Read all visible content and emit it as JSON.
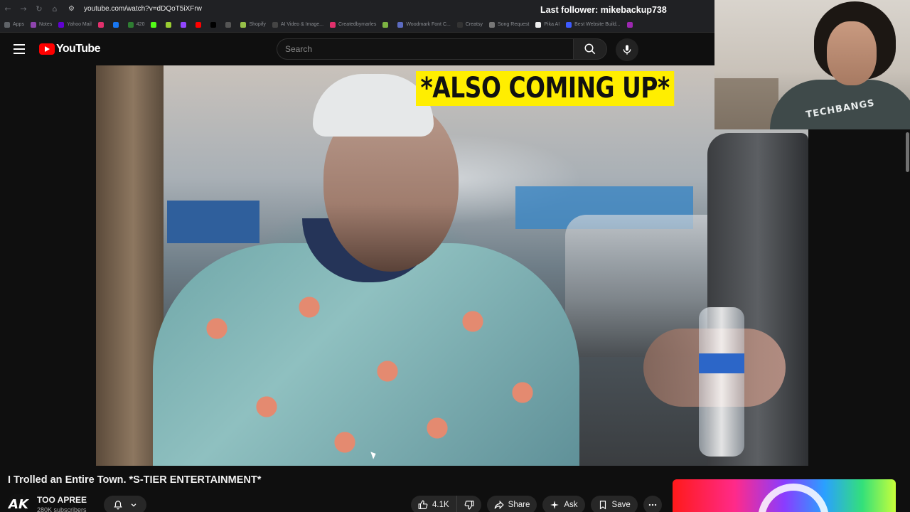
{
  "browser": {
    "url": "youtube.com/watch?v=dDQoT5iXFrw",
    "bookmarks": [
      {
        "label": "Apps",
        "color": "#5f6368"
      },
      {
        "label": "Notes",
        "color": "#8e44ad"
      },
      {
        "label": "Yahoo Mail",
        "color": "#6001d2"
      },
      {
        "label": "",
        "color": "#e1306c"
      },
      {
        "label": "",
        "color": "#1877f2"
      },
      {
        "label": "420",
        "color": "#2e7d32"
      },
      {
        "label": "",
        "color": "#53fc18"
      },
      {
        "label": "",
        "color": "#9acd32"
      },
      {
        "label": "",
        "color": "#9146ff"
      },
      {
        "label": "",
        "color": "#ff0000"
      },
      {
        "label": "",
        "color": "#000000"
      },
      {
        "label": "",
        "color": "#555555"
      },
      {
        "label": "Shopify",
        "color": "#96bf48"
      },
      {
        "label": "AI Video & Image...",
        "color": "#444444"
      },
      {
        "label": "Createdbymarles",
        "color": "#e1306c"
      },
      {
        "label": "",
        "color": "#7cb342"
      },
      {
        "label": "Woodmark Font C...",
        "color": "#5c6bc0"
      },
      {
        "label": "Creatsy",
        "color": "#333333"
      },
      {
        "label": "Song Request",
        "color": "#777777"
      },
      {
        "label": "Pika AI",
        "color": "#eeeeee"
      },
      {
        "label": "Best Website Build...",
        "color": "#3d5afe"
      },
      {
        "label": "",
        "color": "#9c27b0"
      }
    ]
  },
  "stream_overlay": {
    "last_follower": "Last follower: mikebackup738"
  },
  "youtube": {
    "logo_text": "YouTube",
    "search_placeholder": "Search",
    "video": {
      "caption": "*ALSO COMING UP*",
      "title": "I Trolled an Entire Town. *S-TIER ENTERTAINMENT*"
    },
    "channel": {
      "avatar_text": "AK",
      "name": "TOO APREE",
      "subscribers": "280K subscribers"
    },
    "actions": {
      "likes": "4.1K",
      "share": "Share",
      "ask": "Ask",
      "save": "Save"
    }
  },
  "webcam": {
    "shirt_text": "TECHBANGS"
  },
  "colors": {
    "background": "#0f0f0f",
    "brand_red": "#ff0000",
    "caption_yellow": "#ffee00",
    "pill_bg": "#272727"
  }
}
